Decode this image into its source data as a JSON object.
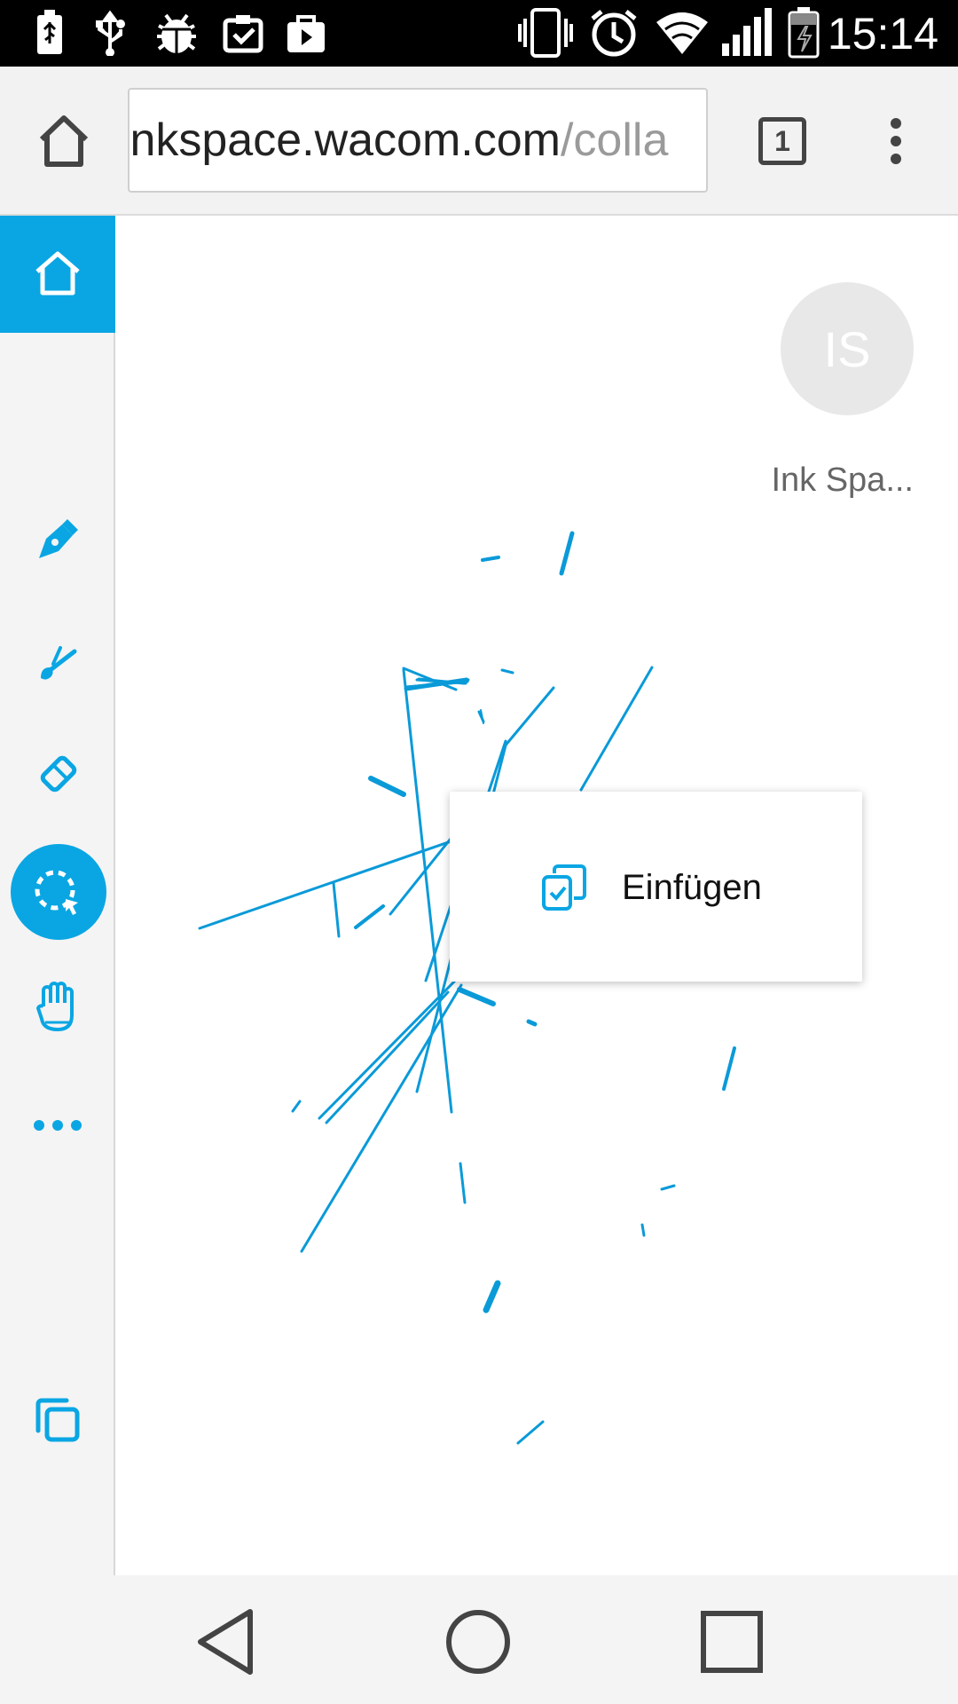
{
  "status_bar": {
    "time": "15:14",
    "icons": [
      "battery-charging-icon",
      "usb-icon",
      "android-debug-icon",
      "clipboard-check-icon",
      "play-store-icon",
      "vibrate-icon",
      "alarm-icon",
      "wifi-icon",
      "signal-icon",
      "battery-icon"
    ]
  },
  "browser": {
    "url_host": "ınkspace.wacom.com",
    "url_path": "/colla",
    "tab_count": "1",
    "icons": [
      "home-icon",
      "tabs-icon",
      "overflow-menu-icon"
    ]
  },
  "toolbar": {
    "tools": [
      "home-icon",
      "pen-icon",
      "brush-icon",
      "eraser-icon",
      "selection-lasso-icon",
      "hand-pan-icon",
      "more-icon",
      "fit-screen-icon"
    ],
    "active_tool": "selection-lasso-icon",
    "accent_color": "#0aa6e3"
  },
  "collaborator": {
    "initials": "IS",
    "name": "Ink Spa..."
  },
  "context_menu": {
    "items": [
      {
        "label": "Einfügen",
        "icon": "paste-icon"
      }
    ]
  },
  "nav_bar": {
    "icons": [
      "back-icon",
      "home-circle-icon",
      "recents-icon"
    ]
  },
  "colors": {
    "ink": "#0a9ad8",
    "accent": "#0aa6e3",
    "status_bar": "#000000",
    "chrome": "#f2f2f2"
  }
}
